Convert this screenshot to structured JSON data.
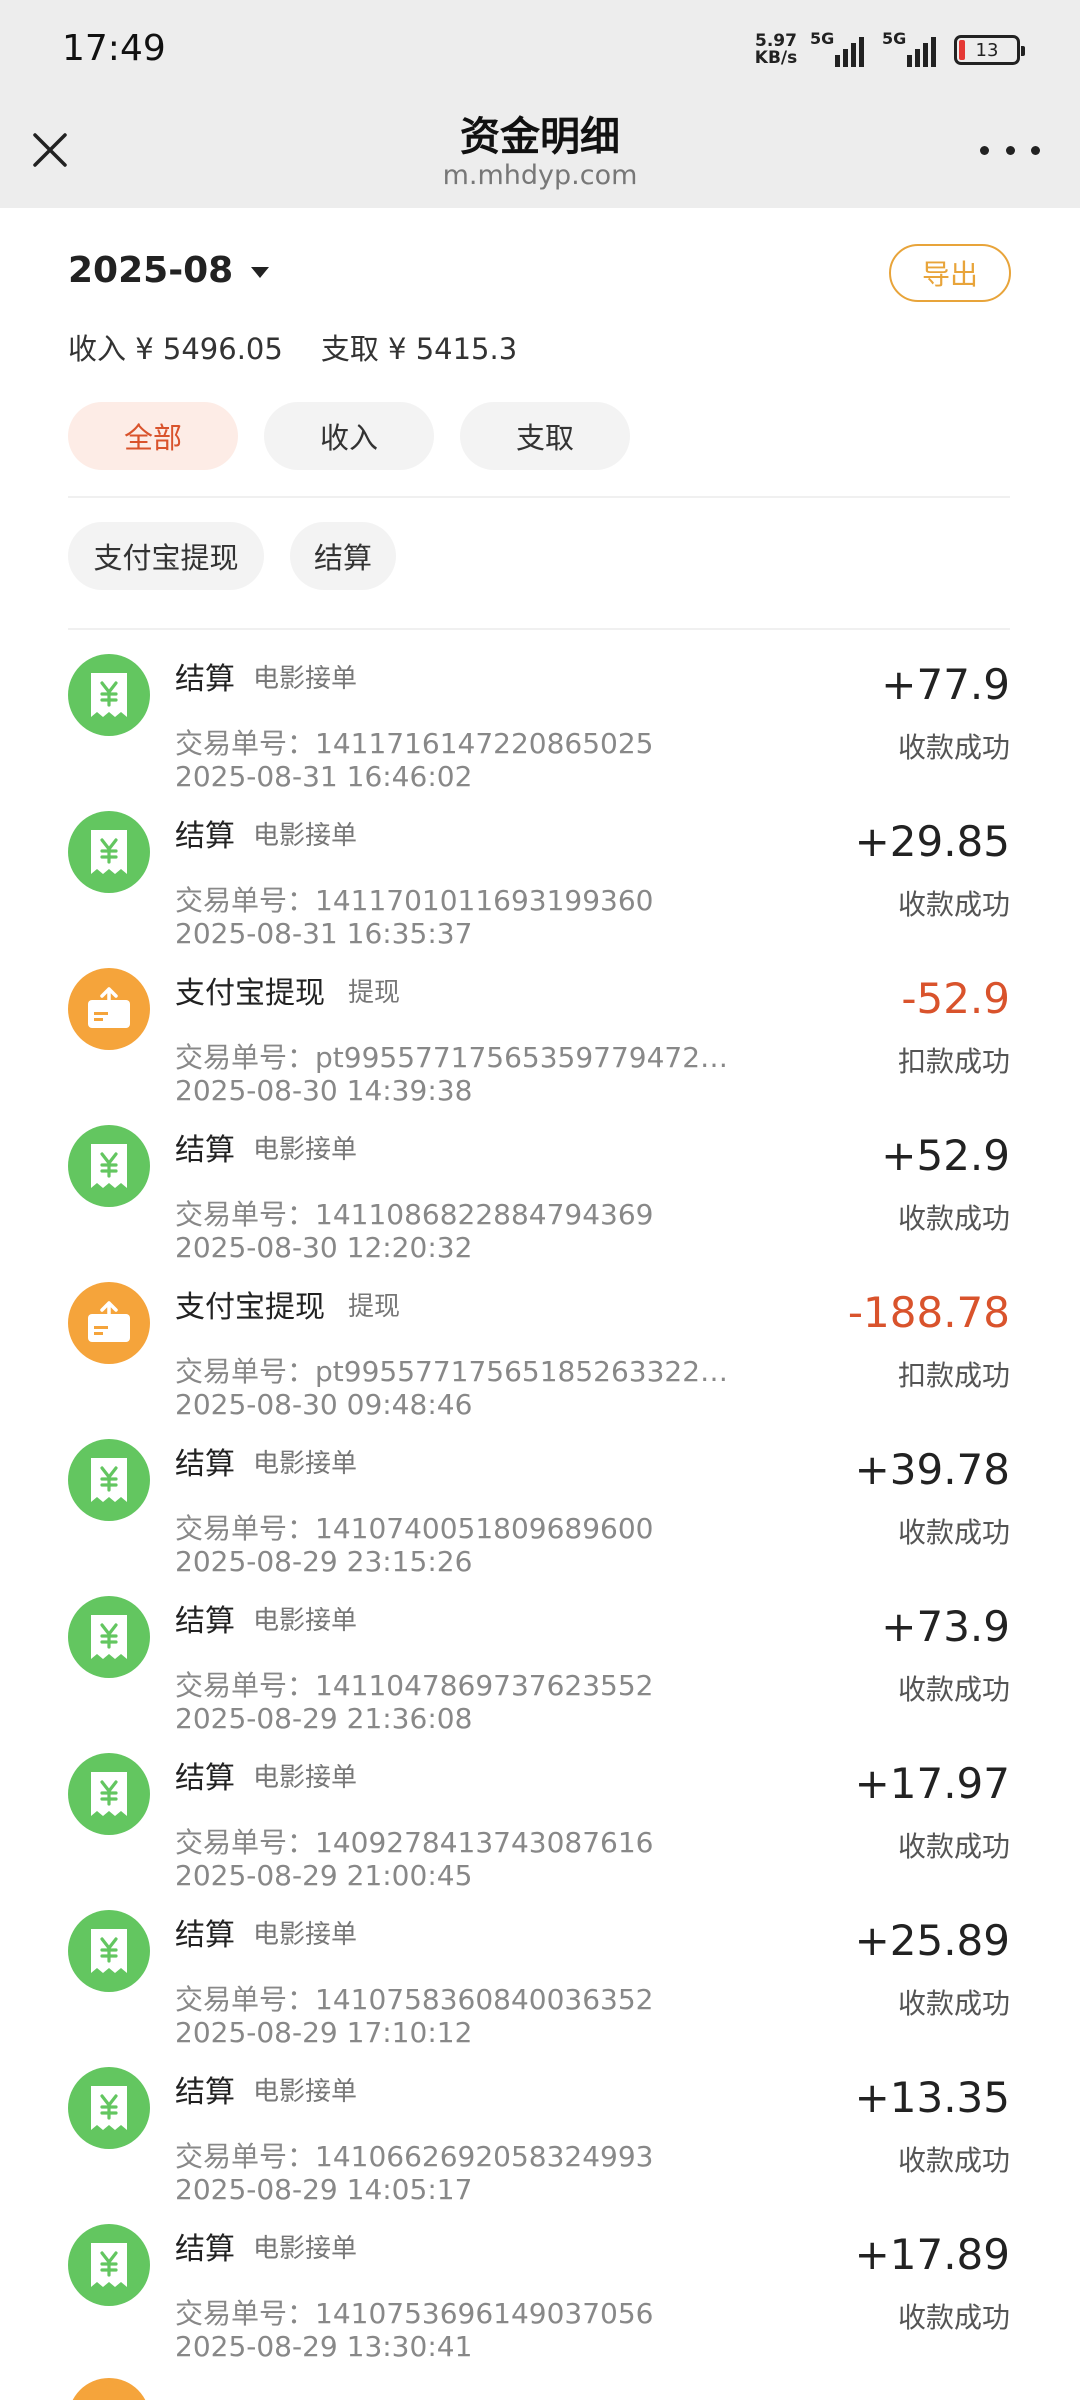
{
  "status_bar": {
    "time": "17:49",
    "net_speed_value": "5.97",
    "net_speed_unit": "KB/s",
    "signal_label_1": "5G",
    "signal_label_2": "5G",
    "battery": "13"
  },
  "header": {
    "title": "资金明细",
    "url": "m.mhdyp.com"
  },
  "month": "2025-08",
  "export_label": "导出",
  "summary": {
    "income": "收入 ¥ 5496.05",
    "withdraw": "支取 ¥ 5415.3"
  },
  "filters_primary": [
    "全部",
    "收入",
    "支取"
  ],
  "filters_secondary": [
    "支付宝提现",
    "结算"
  ],
  "colors": {
    "accent_orange": "#e8a43a",
    "active_red": "#d9532c",
    "settle_green": "#63c660",
    "withdraw_orange": "#f5a43b"
  },
  "transactions": [
    {
      "kind": "settle",
      "title": "结算",
      "subtype": "电影接单",
      "txid": "交易单号：1411716147220865025",
      "time": "2025-08-31 16:46:02",
      "amount": "+77.9",
      "status": "收款成功"
    },
    {
      "kind": "settle",
      "title": "结算",
      "subtype": "电影接单",
      "txid": "交易单号：1411701011693199360",
      "time": "2025-08-31 16:35:37",
      "amount": "+29.85",
      "status": "收款成功"
    },
    {
      "kind": "withdraw",
      "title": "支付宝提现",
      "subtype": "提现",
      "txid": "交易单号：pt99557717565359779472​7...",
      "time": "2025-08-30 14:39:38",
      "amount": "-52.9",
      "status": "扣款成功"
    },
    {
      "kind": "settle",
      "title": "结算",
      "subtype": "电影接单",
      "txid": "交易单号：1411086822884794369",
      "time": "2025-08-30 12:20:32",
      "amount": "+52.9",
      "status": "收款成功"
    },
    {
      "kind": "withdraw",
      "title": "支付宝提现",
      "subtype": "提现",
      "txid": "交易单号：pt995577175651852633227...",
      "time": "2025-08-30 09:48:46",
      "amount": "-188.78",
      "status": "扣款成功"
    },
    {
      "kind": "settle",
      "title": "结算",
      "subtype": "电影接单",
      "txid": "交易单号：1410740051809689600",
      "time": "2025-08-29 23:15:26",
      "amount": "+39.78",
      "status": "收款成功"
    },
    {
      "kind": "settle",
      "title": "结算",
      "subtype": "电影接单",
      "txid": "交易单号：1411047869737623552",
      "time": "2025-08-29 21:36:08",
      "amount": "+73.9",
      "status": "收款成功"
    },
    {
      "kind": "settle",
      "title": "结算",
      "subtype": "电影接单",
      "txid": "交易单号：1409278413743087616",
      "time": "2025-08-29 21:00:45",
      "amount": "+17.97",
      "status": "收款成功"
    },
    {
      "kind": "settle",
      "title": "结算",
      "subtype": "电影接单",
      "txid": "交易单号：1410758360840036352",
      "time": "2025-08-29 17:10:12",
      "amount": "+25.89",
      "status": "收款成功"
    },
    {
      "kind": "settle",
      "title": "结算",
      "subtype": "电影接单",
      "txid": "交易单号：1410662692058324993",
      "time": "2025-08-29 14:05:17",
      "amount": "+13.35",
      "status": "收款成功"
    },
    {
      "kind": "settle",
      "title": "结算",
      "subtype": "电影接单",
      "txid": "交易单号：1410753696149037056",
      "time": "2025-08-29 13:30:41",
      "amount": "+17.89",
      "status": "收款成功"
    }
  ]
}
